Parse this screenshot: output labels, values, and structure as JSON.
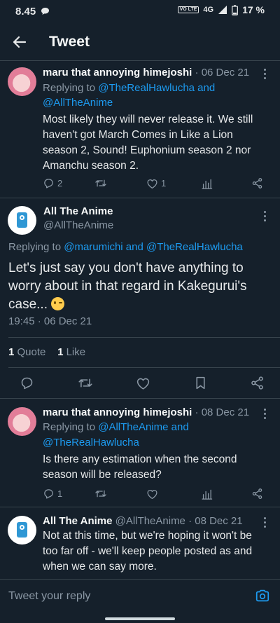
{
  "status_bar": {
    "time": "8.45",
    "network": "4G",
    "volte": "VO LTE",
    "battery": "17 %"
  },
  "header": {
    "title": "Tweet"
  },
  "tweet1": {
    "name": "maru that annoying himejoshi",
    "date": "· 06 Dec 21",
    "replying_prefix": "Replying to",
    "replying_to_1": "@TheRealHawlucha and",
    "replying_to_2": "@AllTheAnime",
    "text": "Most likely they will never release it. We still haven't got March Comes in Like a Lion season 2, Sound! Euphonium season 2 nor Amanchu season 2.",
    "replies": "2",
    "likes": "1"
  },
  "main_tweet": {
    "name": "All The Anime",
    "handle": "@AllTheAnime",
    "replying_prefix": "Replying to",
    "replying_to": "@marumichi and @TheRealHawlucha",
    "text": "Let's just say you don't have anything to worry about in that regard in Kakegurui's case...",
    "timestamp": "19:45 · 06 Dec 21",
    "quotes_count": "1",
    "quotes_label": "Quote",
    "likes_count": "1",
    "likes_label": "Like"
  },
  "tweet3": {
    "name": "maru that annoying himejoshi",
    "date": "· 08 Dec 21",
    "replying_prefix": "Replying to",
    "replying_to_1": "@AllTheAnime and",
    "replying_to_2": "@TheRealHawlucha",
    "text": "Is there any estimation when the second season will be released?",
    "replies": "1"
  },
  "tweet4": {
    "name": "All The Anime",
    "handle": "@AllTheAnime",
    "date": "· 08 Dec 21",
    "text": "Not at this time, but we're hoping it won't be too far off - we'll keep people posted as and when we can say more."
  },
  "reply_box": {
    "placeholder": "Tweet your reply"
  },
  "colors": {
    "background": "#15202b",
    "accent": "#1d9bf0",
    "muted": "#8b98a5",
    "divider": "#38444d"
  }
}
